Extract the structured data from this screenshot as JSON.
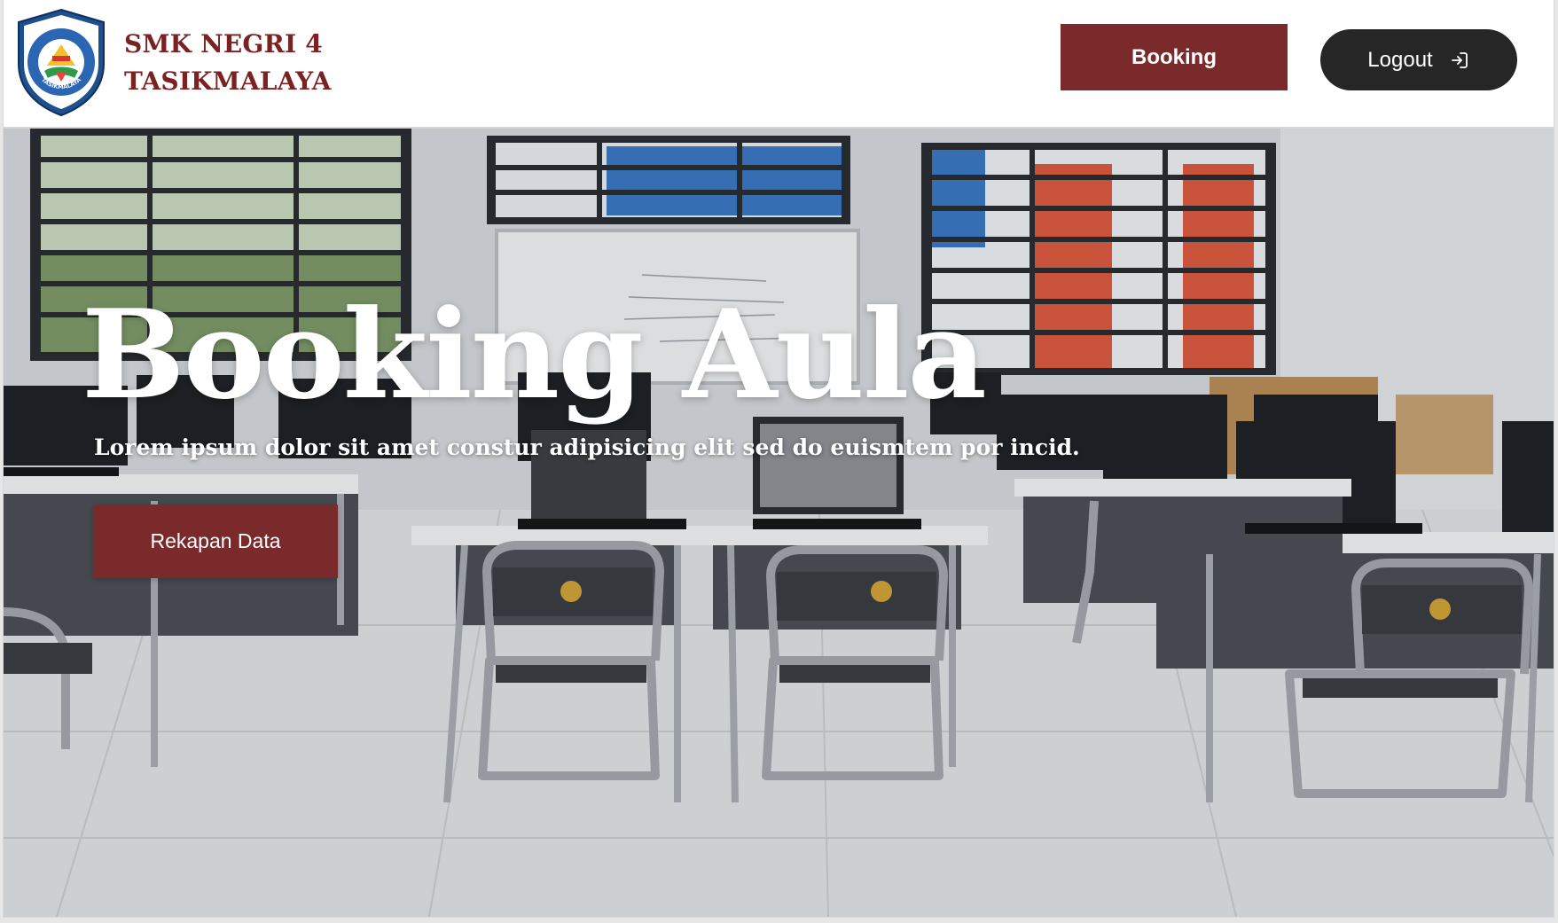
{
  "header": {
    "school_name_line1": "SMK NEGRI 4",
    "school_name_line2": "TASIKMALAYA",
    "logo_text_top": "SMK NEGERI 4",
    "logo_text_bottom": "TASIKMALAYA",
    "booking_label": "Booking",
    "logout_label": "Logout",
    "logout_icon": "logout-icon"
  },
  "hero": {
    "title": "Booking Aula",
    "subtitle": "Lorem ipsum dolor sit amet constur adipisicing elit sed do euismtem por incid.",
    "cta_label": "Rekapan Data",
    "background": "computer lab classroom photo"
  },
  "colors": {
    "brand_red": "#7a2a2a",
    "brand_text_red": "#7b2121",
    "logout_dark": "#262626",
    "white": "#ffffff"
  }
}
